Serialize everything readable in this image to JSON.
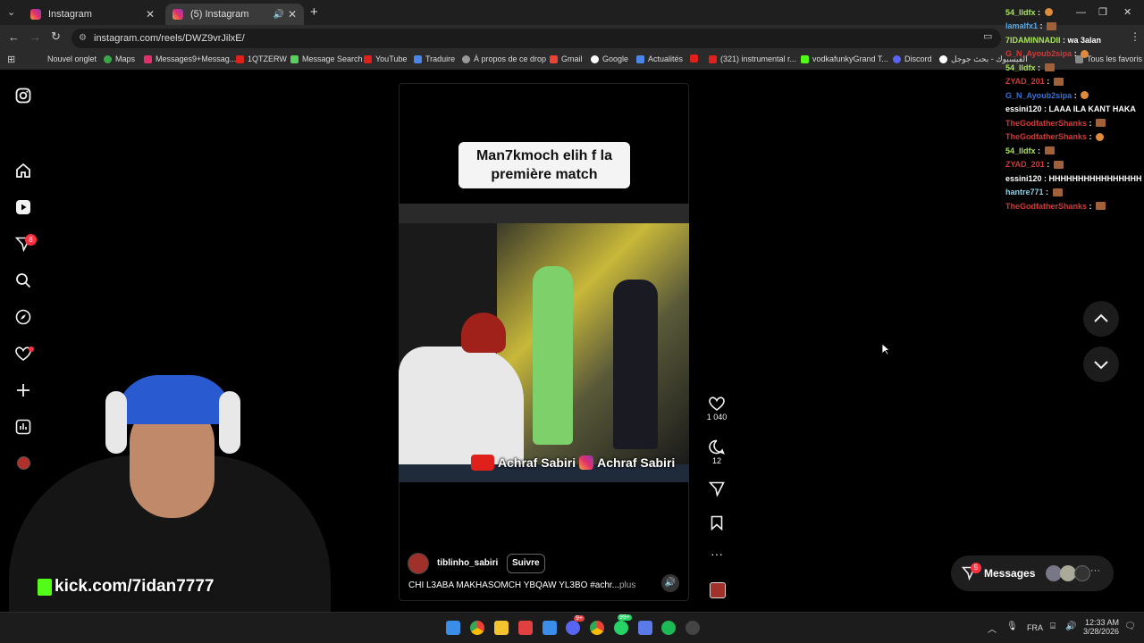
{
  "browser": {
    "tabs": [
      {
        "title": "Instagram"
      },
      {
        "title": "(5) Instagram"
      }
    ],
    "url": "instagram.com/reels/DWZ9vrJilxE/",
    "bookmarks": [
      "Nouvel onglet",
      "Maps",
      "Messages9+Messag...",
      "1QTZERW",
      "Message Search",
      "YouTube",
      "Traduire",
      "À propos de ce drop",
      "Gmail",
      "Google",
      "Actualités",
      "(321) instrumental r...",
      "vodkafunkyGrand T...",
      "Discord",
      "الفيسبوك - بحث جوجل",
      "Tous les favoris"
    ]
  },
  "sidebar": {
    "notification_count": "8"
  },
  "reel": {
    "caption_overlay": "Man7kmoch elih f la première match",
    "watermark": "Achraf Sabiri",
    "likes": "1 040",
    "comments": "12",
    "username": "tiblinho_sabiri",
    "follow_label": "Suivre",
    "description": "CHI L3ABA MAKHASOMCH YBQAW YL3BO #achr...",
    "more_label": "plus"
  },
  "messages": {
    "label": "Messages",
    "count": "5"
  },
  "stream": {
    "overlay_url": "kick.com/7idan7777"
  },
  "chat": [
    {
      "user": "54_lldfx",
      "text": "",
      "color": "#a7e35a"
    },
    {
      "user": "lamalfx1",
      "text": "",
      "color": "#5aa7e3"
    },
    {
      "user": "7IDAMINNADII",
      "text": "wa 3alan",
      "color": "#a7e35a"
    },
    {
      "user": "G_N_Ayoub2sipa",
      "text": "",
      "color": "#d03a3a"
    },
    {
      "user": "54_lldfx",
      "text": "",
      "color": "#a7e35a"
    },
    {
      "user": "ZYAD_201",
      "text": "",
      "color": "#d03a3a"
    },
    {
      "user": "G_N_Ayoub2sipa",
      "text": "",
      "color": "#3a6fd0"
    },
    {
      "user": "essini120",
      "text": "LAAA ILA KANT HAKA",
      "color": "#ffffff"
    },
    {
      "user": "TheGodfatherShanks",
      "text": "",
      "color": "#d03a3a"
    },
    {
      "user": "TheGodfatherShanks",
      "text": "",
      "color": "#d03a3a"
    },
    {
      "user": "54_lldfx",
      "text": "",
      "color": "#a7e35a"
    },
    {
      "user": "ZYAD_201",
      "text": "",
      "color": "#d03a3a"
    },
    {
      "user": "essini120",
      "text": "HHHHHHHHHHHHHHHH",
      "color": "#ffffff"
    },
    {
      "user": "hantre771",
      "text": "",
      "color": "#8fd0e8"
    },
    {
      "user": "TheGodfatherShanks",
      "text": "",
      "color": "#d03a3a"
    }
  ],
  "taskbar": {
    "lang": "FRA",
    "time": "12:33 AM",
    "date": "3/28/2026",
    "badges": [
      "9+",
      "99+"
    ]
  }
}
